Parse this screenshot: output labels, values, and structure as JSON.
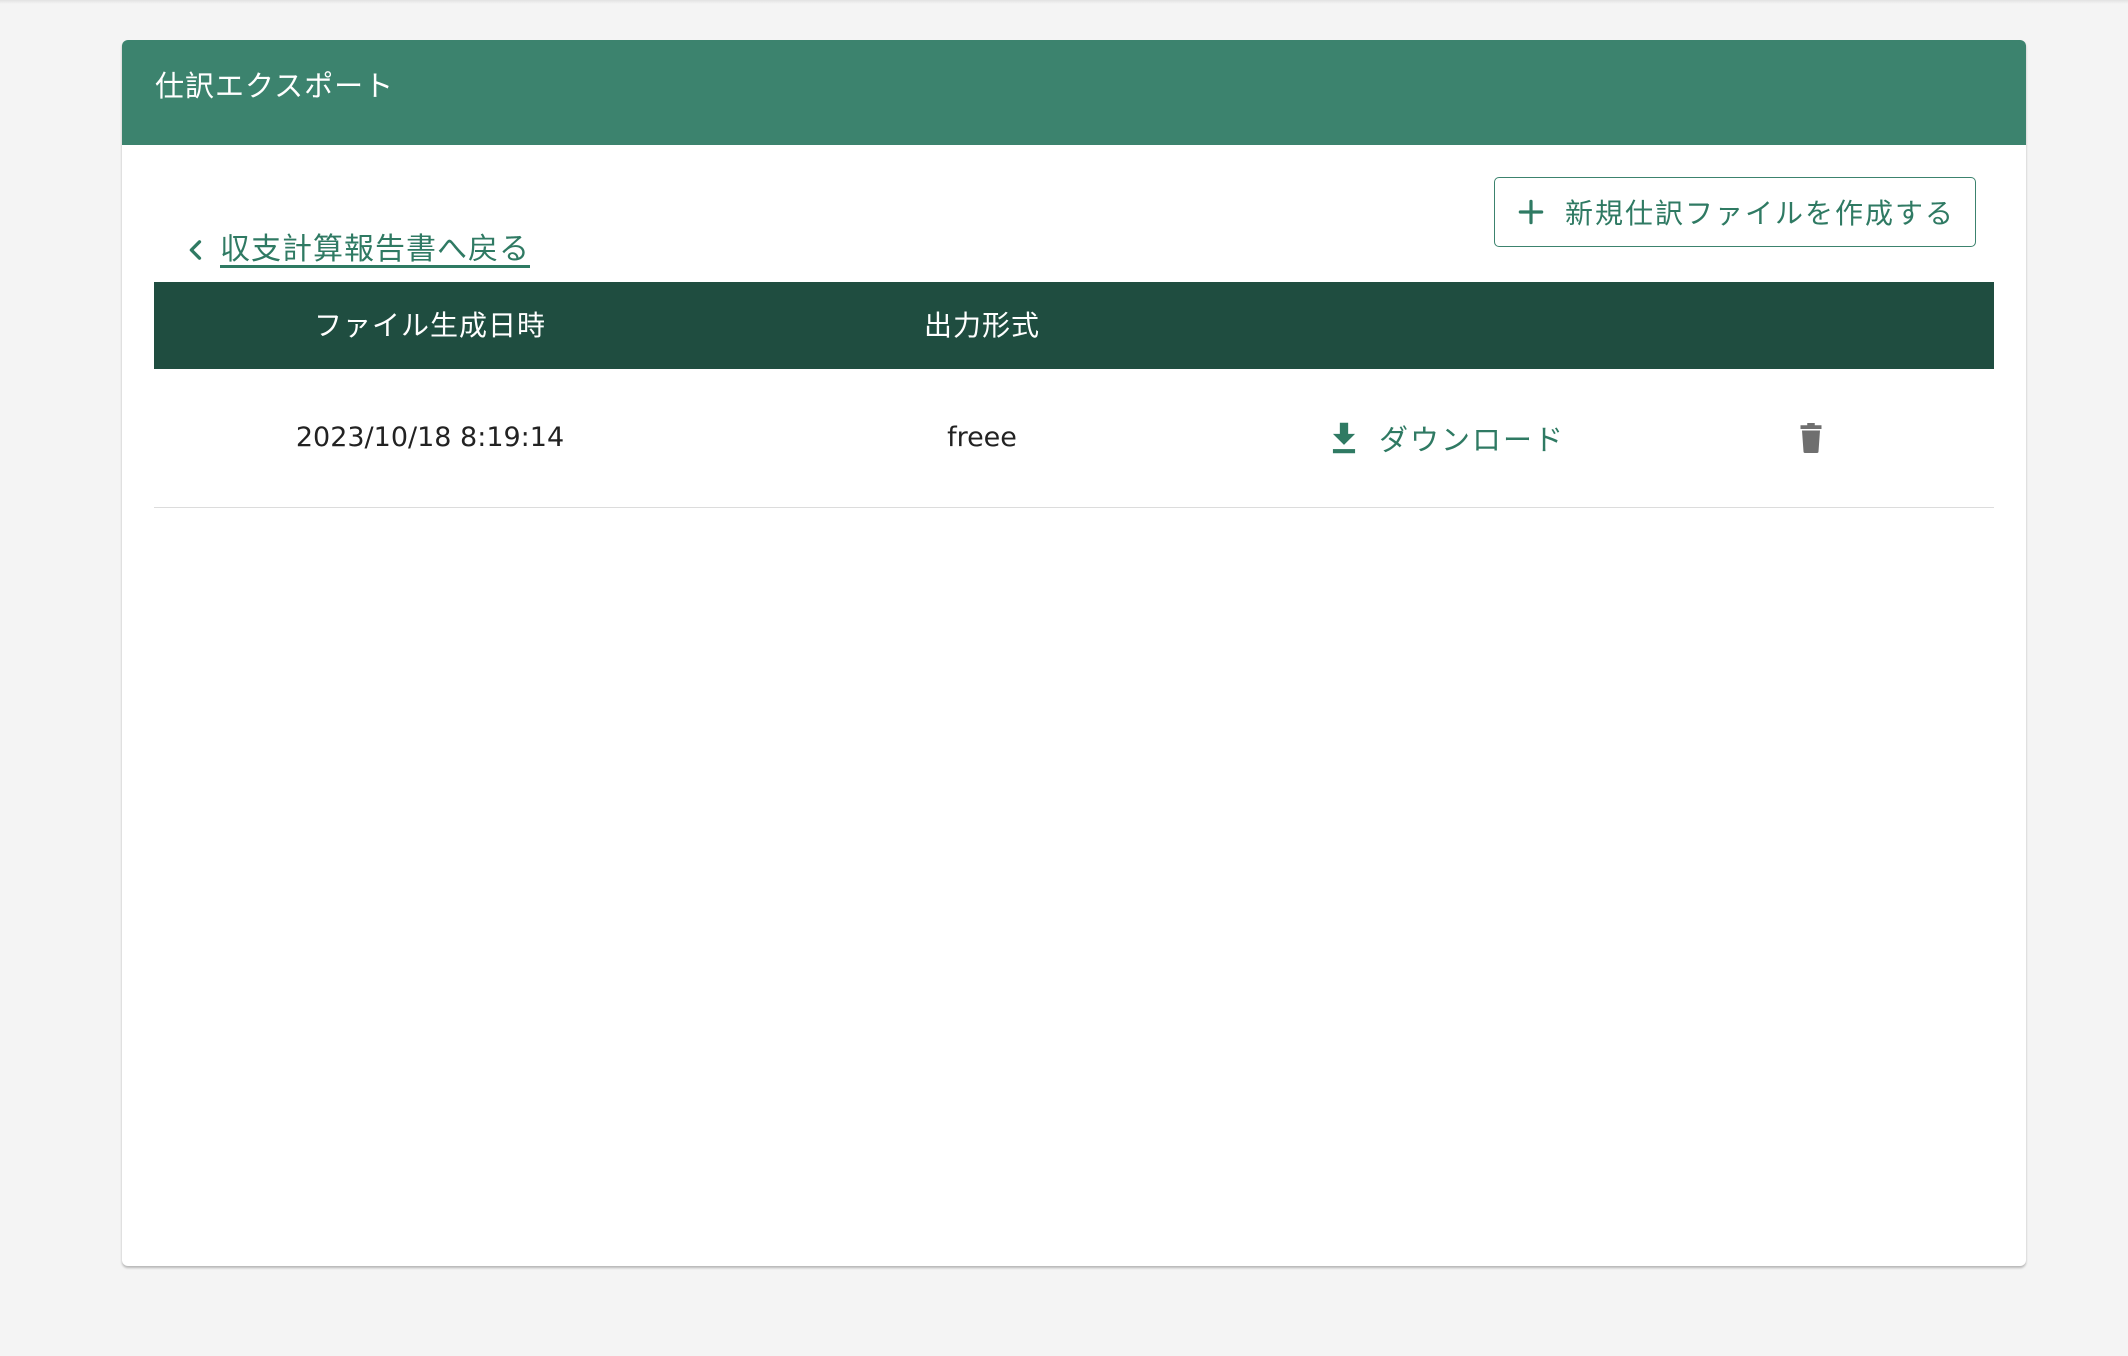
{
  "card": {
    "title": "仕訳エクスポート"
  },
  "actions": {
    "back_label": "収支計算報告書へ戻る",
    "new_file_label": "新規仕訳ファイルを作成する"
  },
  "table": {
    "headers": [
      "ファイル生成日時",
      "出力形式"
    ],
    "rows": [
      {
        "created_at": "2023/10/18 8:19:14",
        "format": "freee",
        "download_label": "ダウンロード"
      }
    ]
  },
  "colors": {
    "header_bg": "#3c836e",
    "table_header_bg": "#1f4d40",
    "accent": "#2f7a63",
    "page_bg": "#f4f4f4",
    "delete_icon": "#6f6f6f"
  },
  "icons": {
    "back": "chevron-left-icon",
    "new_file": "plus-icon",
    "download": "download-icon",
    "delete": "trash-icon"
  }
}
